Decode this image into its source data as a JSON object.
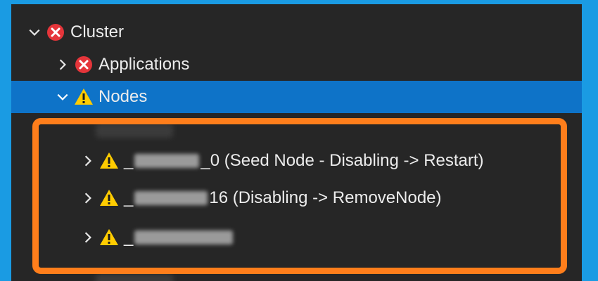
{
  "tree": {
    "cluster": {
      "label": "Cluster",
      "status_icon": "error-icon",
      "expanded": true
    },
    "applications": {
      "label": "Applications",
      "status_icon": "error-icon",
      "expanded": false
    },
    "nodes": {
      "label": "Nodes",
      "status_icon": "warning-icon",
      "expanded": true,
      "selected": true
    },
    "node_items": [
      {
        "prefix": "_",
        "suffix": "_0 (Seed Node - Disabling -> Restart)",
        "status_icon": "warning-icon"
      },
      {
        "prefix": "_",
        "suffix": "16 (Disabling -> RemoveNode)",
        "status_icon": "warning-icon"
      },
      {
        "prefix": "_",
        "suffix": "",
        "status_icon": "warning-icon"
      }
    ]
  },
  "colors": {
    "background": "#1a9be3",
    "panel": "#262626",
    "selected_row": "#0e73c8",
    "error_red": "#e5353a",
    "warning_yellow": "#ffcc00",
    "highlight_orange": "#ff7e1b"
  }
}
